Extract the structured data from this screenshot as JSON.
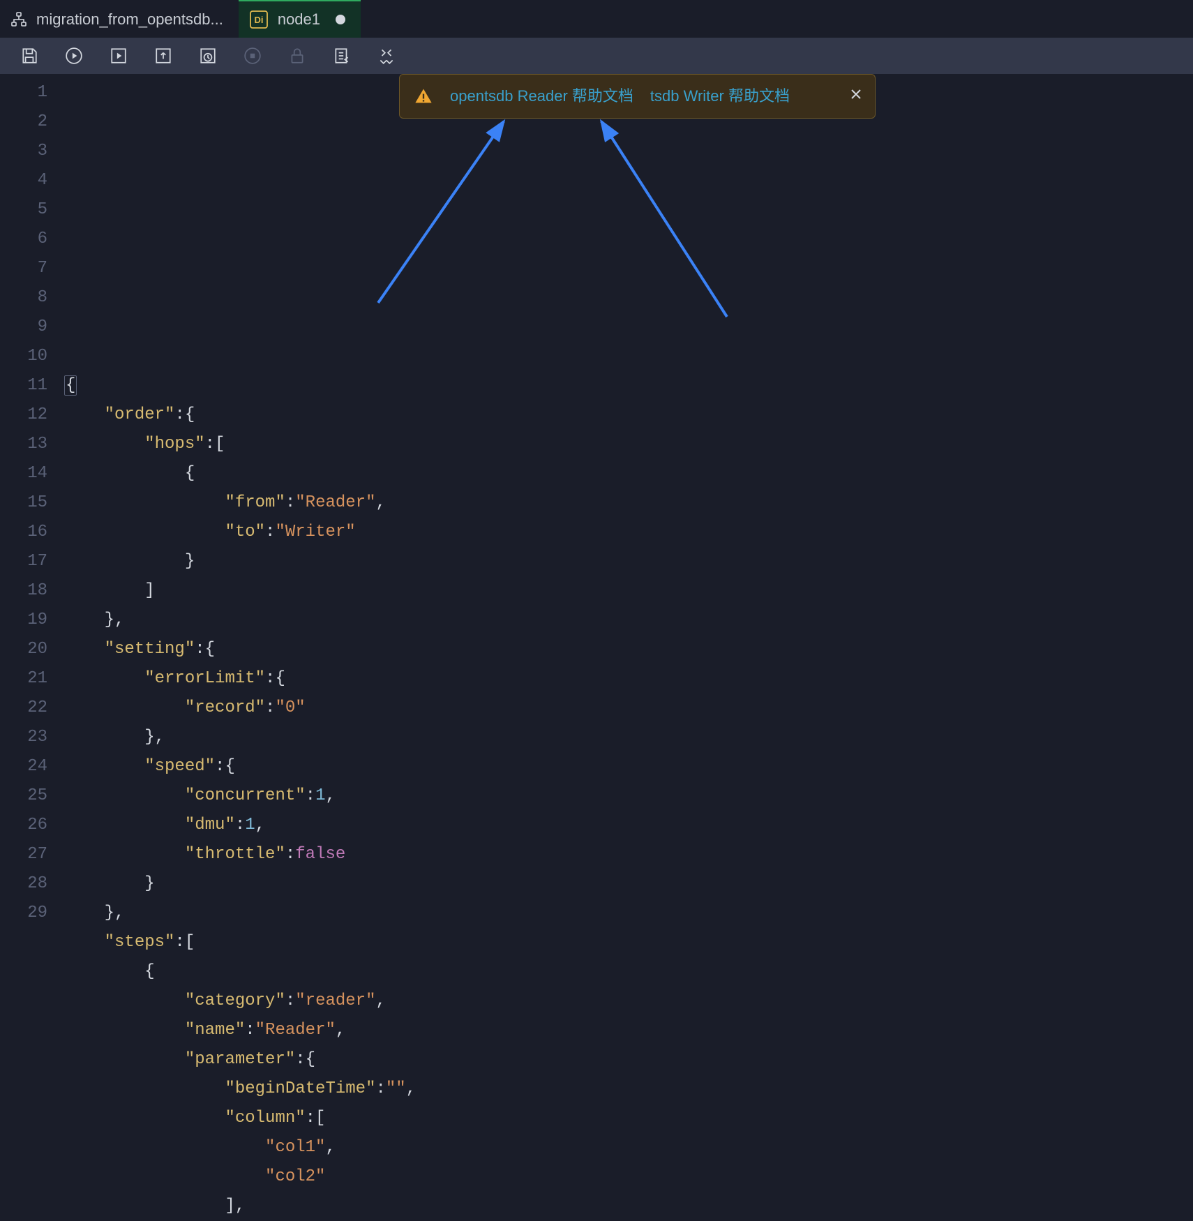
{
  "tabs": [
    {
      "label": "migration_from_opentsdb...",
      "icon": "workflow"
    },
    {
      "label": "node1",
      "icon": "di",
      "active": true,
      "dirty": true
    }
  ],
  "toolbar": {
    "save": "Save",
    "run": "Run",
    "run_debug": "Run with parameters",
    "deploy": "Deploy",
    "schedule": "Schedule",
    "stop": "Stop",
    "lock": "Lock",
    "import": "Import",
    "format": "Format"
  },
  "toast": {
    "link1": "opentsdb Reader 帮助文档",
    "link2": "tsdb Writer 帮助文档"
  },
  "code": [
    {
      "n": 1,
      "spans": [
        {
          "t": "{",
          "c": "punc",
          "box": true
        }
      ]
    },
    {
      "n": 2,
      "indent": 1,
      "spans": [
        {
          "t": "\"order\"",
          "c": "key"
        },
        {
          "t": ":{",
          "c": "punc"
        }
      ]
    },
    {
      "n": 3,
      "indent": 2,
      "spans": [
        {
          "t": "\"hops\"",
          "c": "key"
        },
        {
          "t": ":[",
          "c": "punc"
        }
      ]
    },
    {
      "n": 4,
      "indent": 3,
      "spans": [
        {
          "t": "{",
          "c": "punc"
        }
      ]
    },
    {
      "n": 5,
      "indent": 4,
      "spans": [
        {
          "t": "\"from\"",
          "c": "key"
        },
        {
          "t": ":",
          "c": "punc"
        },
        {
          "t": "\"Reader\"",
          "c": "str"
        },
        {
          "t": ",",
          "c": "punc"
        }
      ]
    },
    {
      "n": 6,
      "indent": 4,
      "spans": [
        {
          "t": "\"to\"",
          "c": "key"
        },
        {
          "t": ":",
          "c": "punc"
        },
        {
          "t": "\"Writer\"",
          "c": "str"
        }
      ]
    },
    {
      "n": 7,
      "indent": 3,
      "spans": [
        {
          "t": "}",
          "c": "punc"
        }
      ]
    },
    {
      "n": 8,
      "indent": 2,
      "spans": [
        {
          "t": "]",
          "c": "punc"
        }
      ]
    },
    {
      "n": 9,
      "indent": 1,
      "spans": [
        {
          "t": "},",
          "c": "punc"
        }
      ]
    },
    {
      "n": 10,
      "indent": 1,
      "spans": [
        {
          "t": "\"setting\"",
          "c": "key"
        },
        {
          "t": ":{",
          "c": "punc"
        }
      ]
    },
    {
      "n": 11,
      "indent": 2,
      "spans": [
        {
          "t": "\"errorLimit\"",
          "c": "key"
        },
        {
          "t": ":{",
          "c": "punc"
        }
      ]
    },
    {
      "n": 12,
      "indent": 3,
      "spans": [
        {
          "t": "\"record\"",
          "c": "key"
        },
        {
          "t": ":",
          "c": "punc"
        },
        {
          "t": "\"0\"",
          "c": "str"
        }
      ]
    },
    {
      "n": 13,
      "indent": 2,
      "spans": [
        {
          "t": "},",
          "c": "punc"
        }
      ]
    },
    {
      "n": 14,
      "indent": 2,
      "spans": [
        {
          "t": "\"speed\"",
          "c": "key"
        },
        {
          "t": ":{",
          "c": "punc"
        }
      ]
    },
    {
      "n": 15,
      "indent": 3,
      "spans": [
        {
          "t": "\"concurrent\"",
          "c": "key"
        },
        {
          "t": ":",
          "c": "punc"
        },
        {
          "t": "1",
          "c": "num"
        },
        {
          "t": ",",
          "c": "punc"
        }
      ]
    },
    {
      "n": 16,
      "indent": 3,
      "spans": [
        {
          "t": "\"dmu\"",
          "c": "key"
        },
        {
          "t": ":",
          "c": "punc"
        },
        {
          "t": "1",
          "c": "num"
        },
        {
          "t": ",",
          "c": "punc"
        }
      ]
    },
    {
      "n": 17,
      "indent": 3,
      "spans": [
        {
          "t": "\"throttle\"",
          "c": "key"
        },
        {
          "t": ":",
          "c": "punc"
        },
        {
          "t": "false",
          "c": "bool"
        }
      ]
    },
    {
      "n": 18,
      "indent": 2,
      "spans": [
        {
          "t": "}",
          "c": "punc"
        }
      ]
    },
    {
      "n": 19,
      "indent": 1,
      "spans": [
        {
          "t": "},",
          "c": "punc"
        }
      ]
    },
    {
      "n": 20,
      "indent": 1,
      "spans": [
        {
          "t": "\"steps\"",
          "c": "key"
        },
        {
          "t": ":[",
          "c": "punc"
        }
      ]
    },
    {
      "n": 21,
      "indent": 2,
      "spans": [
        {
          "t": "{",
          "c": "punc"
        }
      ]
    },
    {
      "n": 22,
      "indent": 3,
      "spans": [
        {
          "t": "\"category\"",
          "c": "key"
        },
        {
          "t": ":",
          "c": "punc"
        },
        {
          "t": "\"reader\"",
          "c": "str"
        },
        {
          "t": ",",
          "c": "punc"
        }
      ]
    },
    {
      "n": 23,
      "indent": 3,
      "spans": [
        {
          "t": "\"name\"",
          "c": "key"
        },
        {
          "t": ":",
          "c": "punc"
        },
        {
          "t": "\"Reader\"",
          "c": "str"
        },
        {
          "t": ",",
          "c": "punc"
        }
      ]
    },
    {
      "n": 24,
      "indent": 3,
      "spans": [
        {
          "t": "\"parameter\"",
          "c": "key"
        },
        {
          "t": ":{",
          "c": "punc"
        }
      ]
    },
    {
      "n": 25,
      "indent": 4,
      "spans": [
        {
          "t": "\"beginDateTime\"",
          "c": "key"
        },
        {
          "t": ":",
          "c": "punc"
        },
        {
          "t": "\"\"",
          "c": "str"
        },
        {
          "t": ",",
          "c": "punc"
        }
      ]
    },
    {
      "n": 26,
      "indent": 4,
      "spans": [
        {
          "t": "\"column\"",
          "c": "key"
        },
        {
          "t": ":[",
          "c": "punc"
        }
      ]
    },
    {
      "n": 27,
      "indent": 5,
      "spans": [
        {
          "t": "\"col1\"",
          "c": "str"
        },
        {
          "t": ",",
          "c": "punc"
        }
      ]
    },
    {
      "n": 28,
      "indent": 5,
      "spans": [
        {
          "t": "\"col2\"",
          "c": "str"
        }
      ]
    },
    {
      "n": 29,
      "indent": 4,
      "spans": [
        {
          "t": "],",
          "c": "punc"
        }
      ]
    }
  ],
  "editor_source": {
    "order": {
      "hops": [
        {
          "from": "Reader",
          "to": "Writer"
        }
      ]
    },
    "setting": {
      "errorLimit": {
        "record": "0"
      },
      "speed": {
        "concurrent": 1,
        "dmu": 1,
        "throttle": false
      }
    },
    "steps": [
      {
        "category": "reader",
        "name": "Reader",
        "parameter": {
          "beginDateTime": "",
          "column": [
            "col1",
            "col2"
          ]
        }
      }
    ]
  }
}
